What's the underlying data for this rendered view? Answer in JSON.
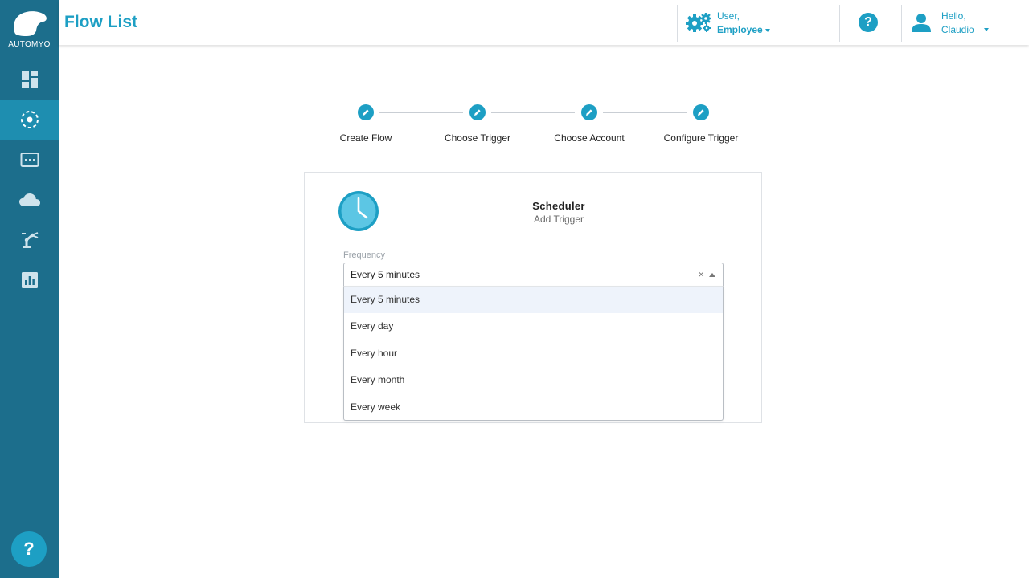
{
  "app": {
    "brand": "AUTOMYO"
  },
  "header": {
    "title": "Flow List",
    "user_switch": {
      "line1": "User,",
      "line2": "Employee"
    },
    "user_menu": {
      "line1": "Hello,",
      "line2": "Claudio"
    }
  },
  "sidebar": {
    "items": [
      {
        "icon": "dashboard-icon"
      },
      {
        "icon": "flow-icon",
        "active": true
      },
      {
        "icon": "terminal-icon"
      },
      {
        "icon": "cloud-icon"
      },
      {
        "icon": "robot-arm-icon"
      },
      {
        "icon": "analytics-icon"
      }
    ],
    "help_label": "?"
  },
  "stepper": {
    "steps": [
      {
        "label": "Create Flow"
      },
      {
        "label": "Choose Trigger"
      },
      {
        "label": "Choose Account"
      },
      {
        "label": "Configure Trigger"
      }
    ]
  },
  "card": {
    "title": "Scheduler",
    "subtitle": "Add Trigger",
    "field_label": "Frequency",
    "select_value": "Every 5 minutes",
    "clear_symbol": "×",
    "options": [
      "Every 5 minutes",
      "Every day",
      "Every hour",
      "Every month",
      "Every week"
    ],
    "selected_index": 0
  },
  "colors": {
    "accent": "#1d9fc4",
    "sidebar": "#1c6e8c",
    "sidebar_active": "#1e8eb0"
  }
}
